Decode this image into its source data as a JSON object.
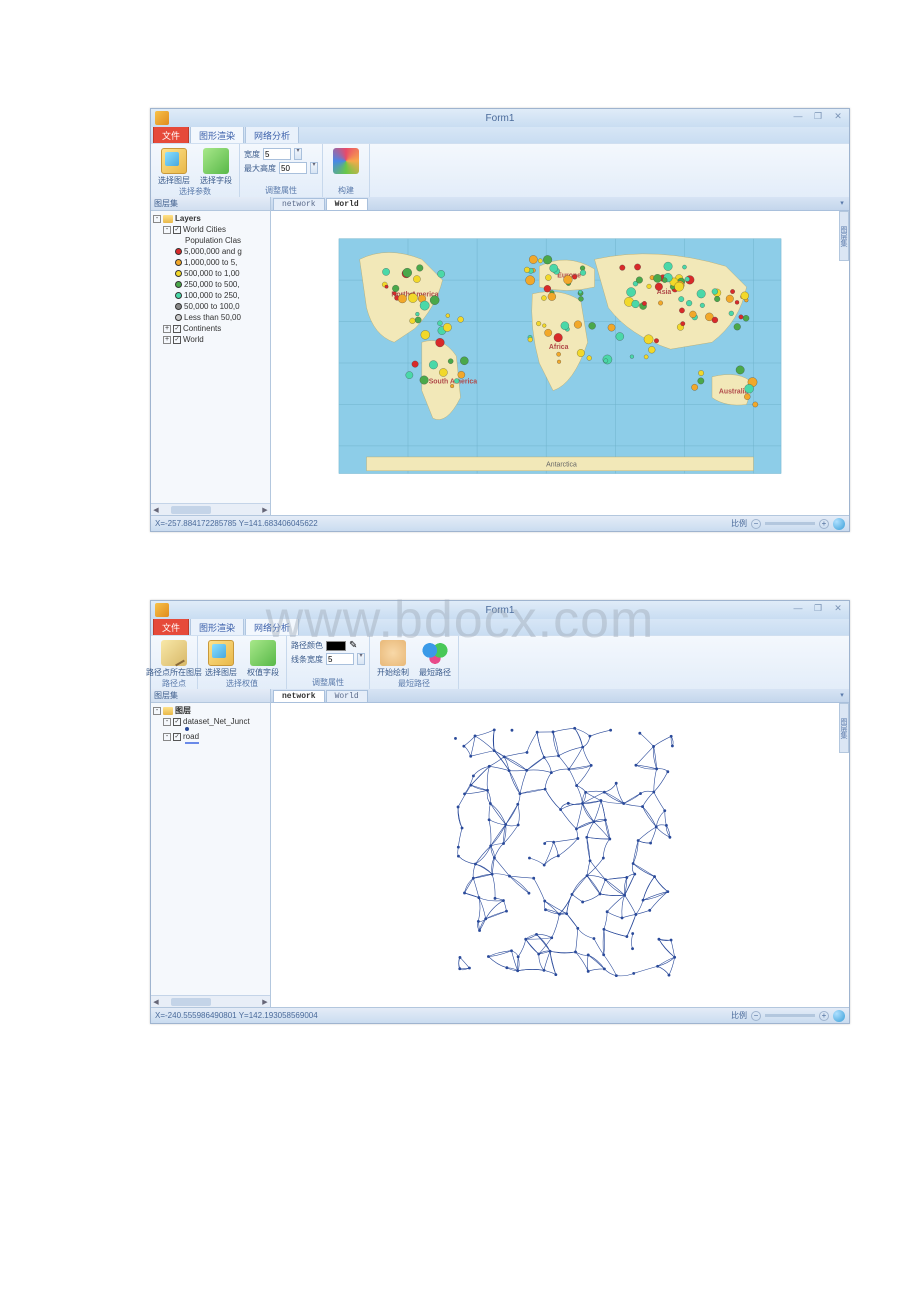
{
  "watermark": "www.bdocx.com",
  "window1": {
    "title": "Form1",
    "tabs": [
      "文件",
      "图形渲染",
      "网络分析"
    ],
    "active_tab": 0,
    "ribbon": {
      "group1": {
        "btn1": "选择图层",
        "btn2": "选择字段",
        "label": "选择参数"
      },
      "group2": {
        "width_label": "宽度",
        "width_val": "5",
        "maxh_label": "最大高度",
        "maxh_val": "50",
        "label": "调整属性"
      },
      "group3": {
        "btn": "",
        "label": "构建"
      }
    },
    "sidebar_title": "图层集",
    "tree": {
      "root": "Layers",
      "cities": "World Cities",
      "pop_header": "Population Clas",
      "legend": [
        {
          "color": "#d82a2a",
          "label": "5,000,000 and g"
        },
        {
          "color": "#f2a82a",
          "label": "1,000,000 to 5,"
        },
        {
          "color": "#f2d82a",
          "label": "500,000 to 1,00"
        },
        {
          "color": "#4aa84a",
          "label": "250,000 to 500,"
        },
        {
          "color": "#4ad8a8",
          "label": "100,000 to 250,"
        },
        {
          "color": "#888",
          "label": "50,000 to 100,0"
        },
        {
          "color": "#ccc",
          "label": "Less than 50,00"
        }
      ],
      "continents": "Continents",
      "world": "World"
    },
    "map_tabs": [
      "network",
      "World"
    ],
    "map_active": 1,
    "continents_labels": [
      "North America",
      "South America",
      "Africa",
      "Europe",
      "Asia",
      "Australia",
      "Antarctica"
    ],
    "status_xy": "X=-257.884172285785  Y=141.683406045622",
    "scale_label": "比例",
    "side_handle": "图层集"
  },
  "window2": {
    "title": "Form1",
    "tabs": [
      "文件",
      "图形渲染",
      "网络分析"
    ],
    "active_tab": 2,
    "ribbon": {
      "group1": {
        "btn1": "路径点所在图层",
        "label": "路径点"
      },
      "group2": {
        "btn1": "选择图层",
        "btn2": "权值字段",
        "label": "选择权值"
      },
      "group3": {
        "color_label": "路径颜色",
        "width_label": "线条宽度",
        "width_val": "5",
        "label": "调整属性"
      },
      "group4": {
        "btn1": "开始绘制",
        "btn2": "最短路径",
        "label": "最短路径"
      }
    },
    "sidebar_title": "图层集",
    "tree": {
      "root": "图层",
      "dataset": "dataset_Net_Junct",
      "road": "road"
    },
    "map_tabs": [
      "network",
      "World"
    ],
    "map_active": 0,
    "status_xy": "X=-240.555986490801  Y=142.193058569004",
    "scale_label": "比例",
    "side_handle": "图层集"
  }
}
